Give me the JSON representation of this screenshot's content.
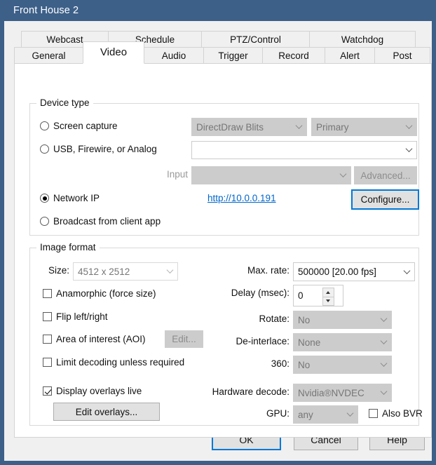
{
  "window": {
    "title": "Front House 2"
  },
  "tabs": {
    "top_row": [
      {
        "label": "Webcast",
        "selected": false
      },
      {
        "label": "Schedule",
        "selected": false
      },
      {
        "label": "PTZ/Control",
        "selected": false
      },
      {
        "label": "Watchdog",
        "selected": false
      }
    ],
    "bottom_row": [
      {
        "label": "General",
        "selected": false
      },
      {
        "label": "Video",
        "selected": true
      },
      {
        "label": "Audio",
        "selected": false
      },
      {
        "label": "Trigger",
        "selected": false
      },
      {
        "label": "Record",
        "selected": false
      },
      {
        "label": "Alert",
        "selected": false
      },
      {
        "label": "Post",
        "selected": false
      }
    ]
  },
  "device_type": {
    "group_title": "Device type",
    "screen_capture": {
      "label": "Screen capture",
      "checked": false,
      "method_value": "DirectDraw Blits",
      "monitor_value": "Primary"
    },
    "usb_firewire_analog": {
      "label": "USB, Firewire, or Analog",
      "checked": false,
      "device_value": ""
    },
    "input": {
      "label": "Input",
      "value": "",
      "advanced_button": "Advanced..."
    },
    "network_ip": {
      "label": "Network IP",
      "checked": true,
      "url": "http://10.0.0.191",
      "configure_button": "Configure..."
    },
    "broadcast": {
      "label": "Broadcast from client app",
      "checked": false
    }
  },
  "image_format": {
    "group_title": "Image format",
    "size": {
      "label": "Size:",
      "value": "4512 x 2512"
    },
    "anamorphic": {
      "label": "Anamorphic (force size)",
      "checked": false
    },
    "flip": {
      "label": "Flip left/right",
      "checked": false
    },
    "aoi": {
      "label": "Area of interest (AOI)",
      "checked": false,
      "edit_button": "Edit..."
    },
    "limit_decoding": {
      "label": "Limit decoding unless required",
      "checked": false
    },
    "display_overlays": {
      "label": "Display overlays live",
      "checked": true
    },
    "edit_overlays_button": "Edit overlays...",
    "max_rate": {
      "label": "Max. rate:",
      "value": "500000 [20.00 fps]"
    },
    "delay": {
      "label": "Delay (msec):",
      "value": "0"
    },
    "rotate": {
      "label": "Rotate:",
      "value": "No"
    },
    "deinterlace": {
      "label": "De-interlace:",
      "value": "None"
    },
    "threesixty": {
      "label": "360:",
      "value": "No"
    },
    "hardware_decode": {
      "label": "Hardware decode:",
      "value": "Nvidia®NVDEC"
    },
    "gpu": {
      "label": "GPU:",
      "value": "any"
    },
    "also_bvr": {
      "label": "Also BVR",
      "checked": false
    }
  },
  "footer": {
    "ok": "OK",
    "cancel": "Cancel",
    "help": "Help"
  },
  "colors": {
    "titlebar": "#3d6089",
    "focus": "#0078d7",
    "link": "#0066cc"
  }
}
